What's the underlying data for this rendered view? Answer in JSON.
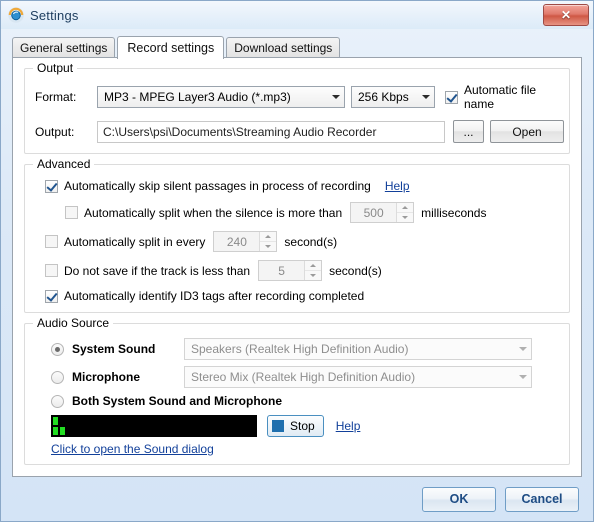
{
  "window": {
    "title": "Settings",
    "app_icon": "recorder-lens-icon",
    "close_label": "✕"
  },
  "tabs": [
    {
      "label": "General settings",
      "active": false
    },
    {
      "label": "Record settings",
      "active": true
    },
    {
      "label": "Download settings",
      "active": false
    }
  ],
  "output": {
    "group_title": "Output",
    "format_label": "Format:",
    "format_value": "MP3 - MPEG Layer3 Audio (*.mp3)",
    "bitrate_value": "256 Kbps",
    "auto_file_name_label": "Automatic file name",
    "auto_file_name_checked": true,
    "output_label": "Output:",
    "output_path": "C:\\Users\\psi\\Documents\\Streaming Audio Recorder",
    "browse_label": "...",
    "open_label": "Open"
  },
  "advanced": {
    "group_title": "Advanced",
    "skip_silent_label": "Automatically skip silent passages in process of recording",
    "skip_silent_checked": true,
    "skip_silent_help": "Help",
    "split_silence_label": "Automatically split when the silence is more than",
    "split_silence_checked": false,
    "split_silence_value": "500",
    "split_silence_unit": "milliseconds",
    "split_every_label": "Automatically split in every",
    "split_every_checked": false,
    "split_every_value": "240",
    "split_every_unit": "second(s)",
    "min_track_label": "Do not save if the track is less than",
    "min_track_checked": false,
    "min_track_value": "5",
    "min_track_unit": "second(s)",
    "id3_label": "Automatically identify ID3 tags after recording completed",
    "id3_checked": true
  },
  "audio_source": {
    "group_title": "Audio Source",
    "system_sound_label": "System Sound",
    "system_sound_selected": true,
    "system_sound_device": "Speakers (Realtek High Definition Audio)",
    "microphone_label": "Microphone",
    "microphone_selected": false,
    "microphone_device": "Stereo Mix (Realtek High Definition Audio)",
    "both_label": "Both System Sound and Microphone",
    "both_selected": false,
    "meter": {
      "name": "audio-level-meter",
      "top_row_segments": 1,
      "bottom_row_segments": 2,
      "segment_color": "#22dd22",
      "background_color": "#000000"
    },
    "stop_label": "Stop",
    "stop_help": "Help",
    "sound_dialog_link": "Click to open the Sound dialog"
  },
  "footer": {
    "ok_label": "OK",
    "cancel_label": "Cancel"
  },
  "colors": {
    "window_background": "#d4e4f6",
    "page_background": "#ffffff",
    "link": "#12409a",
    "accent_button_text": "#1e4c84",
    "close_button": "#cf5845"
  }
}
